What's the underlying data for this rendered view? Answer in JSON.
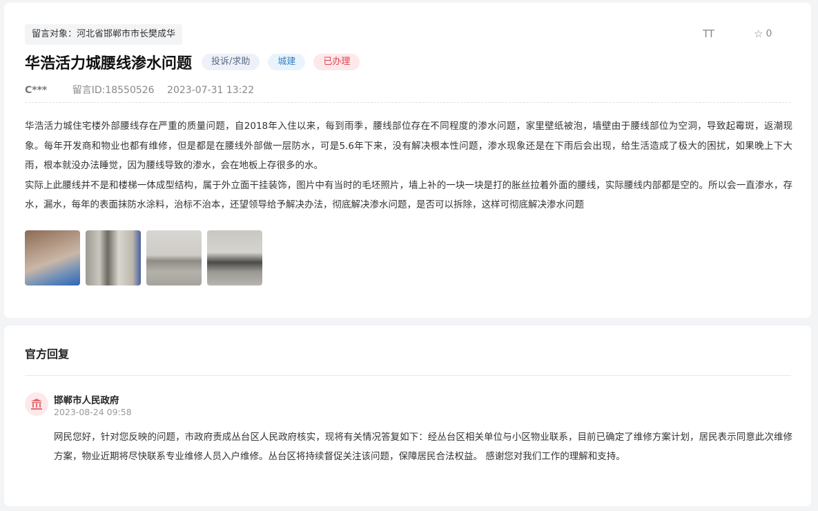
{
  "message": {
    "target_label": "留言对象：河北省邯郸市市长樊成华",
    "font_size_icon": "text-size-icon",
    "font_size_glyph": "TT",
    "favorite_icon": "star-outline-icon",
    "favorite_count": "0",
    "title": "华浩活力城腰线渗水问题",
    "tags": {
      "type": "投诉/求助",
      "category": "城建",
      "status": "已办理"
    },
    "author": "C***",
    "message_id": "留言ID:18550526",
    "datetime": "2023-07-31 13:22",
    "paragraphs": [
      "华浩活力城住宅楼外部腰线存在严重的质量问题，自2018年入住以来，每到雨季，腰线部位存在不同程度的渗水问题，家里壁纸被泡，墙壁由于腰线部位为空洞，导致起霉斑，返潮现象。每年开发商和物业也都有维修，但是都是在腰线外部做一层防水，可是5.6年下来，没有解决根本性问题，渗水现象还是在下雨后会出现，给生活造成了极大的困扰，如果晚上下大雨，根本就没办法睡觉，因为腰线导致的渗水，会在地板上存很多的水。",
      "实际上此腰线并不是和楼梯一体成型结构，属于外立面干挂装饰，图片中有当时的毛坯照片，墙上补的一块一块是打的胀丝拉着外面的腰线，实际腰线内部都是空的。所以会一直渗水，存水，漏水，每年的表面抹防水涂料，治标不治本，还望领导给予解决办法，彻底解决渗水问题，是否可以拆除，这样可彻底解决渗水问题"
    ]
  },
  "reply": {
    "section_title": "官方回复",
    "org_icon": "government-building-icon",
    "org_name": "邯郸市人民政府",
    "date": "2023-08-24 09:58",
    "text": "网民您好，针对您反映的问题，市政府责成丛台区人民政府核实，现将有关情况答复如下：经丛台区相关单位与小区物业联系，目前已确定了维修方案计划，居民表示同意此次维修方案，物业近期将尽快联系专业维修人员入户维修。丛台区将持续督促关注该问题，保障居民合法权益。 感谢您对我们工作的理解和支持。"
  }
}
